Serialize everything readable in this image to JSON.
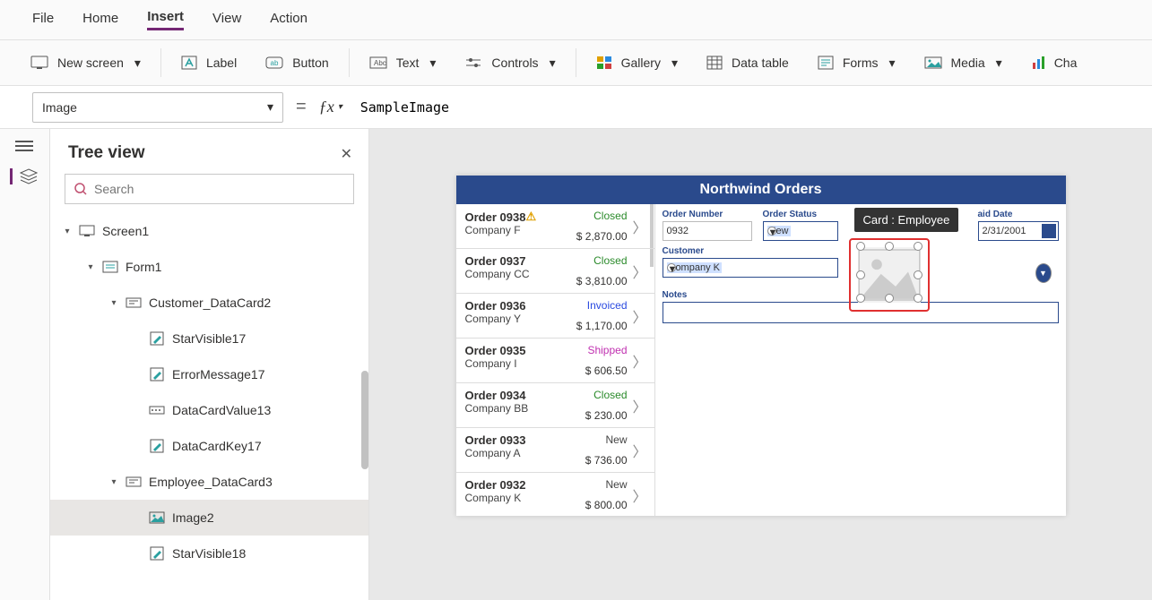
{
  "menu": {
    "items": [
      "File",
      "Home",
      "Insert",
      "View",
      "Action"
    ],
    "active": 2
  },
  "ribbon": {
    "new_screen": "New screen",
    "label": "Label",
    "button": "Button",
    "text": "Text",
    "controls": "Controls",
    "gallery": "Gallery",
    "data_table": "Data table",
    "forms": "Forms",
    "media": "Media",
    "charts": "Cha"
  },
  "formula": {
    "property": "Image",
    "value": "SampleImage"
  },
  "tree": {
    "title": "Tree view",
    "search_placeholder": "Search",
    "nodes": [
      {
        "depth": 0,
        "caret": "▾",
        "icon": "screen",
        "label": "Screen1"
      },
      {
        "depth": 1,
        "caret": "▾",
        "icon": "form",
        "label": "Form1"
      },
      {
        "depth": 2,
        "caret": "▾",
        "icon": "card",
        "label": "Customer_DataCard2"
      },
      {
        "depth": 3,
        "caret": "",
        "icon": "edit",
        "label": "StarVisible17"
      },
      {
        "depth": 3,
        "caret": "",
        "icon": "edit",
        "label": "ErrorMessage17"
      },
      {
        "depth": 3,
        "caret": "",
        "icon": "combo",
        "label": "DataCardValue13"
      },
      {
        "depth": 3,
        "caret": "",
        "icon": "edit",
        "label": "DataCardKey17"
      },
      {
        "depth": 2,
        "caret": "▾",
        "icon": "card",
        "label": "Employee_DataCard3"
      },
      {
        "depth": 3,
        "caret": "",
        "icon": "image",
        "label": "Image2",
        "selected": true
      },
      {
        "depth": 3,
        "caret": "",
        "icon": "edit",
        "label": "StarVisible18"
      }
    ]
  },
  "app": {
    "title": "Northwind Orders",
    "tooltip": "Card : Employee",
    "orders": [
      {
        "id": "Order 0938",
        "company": "Company F",
        "status": "Closed",
        "amount": "$ 2,870.00",
        "warn": true
      },
      {
        "id": "Order 0937",
        "company": "Company CC",
        "status": "Closed",
        "amount": "$ 3,810.00"
      },
      {
        "id": "Order 0936",
        "company": "Company Y",
        "status": "Invoiced",
        "amount": "$ 1,170.00"
      },
      {
        "id": "Order 0935",
        "company": "Company I",
        "status": "Shipped",
        "amount": "$ 606.50"
      },
      {
        "id": "Order 0934",
        "company": "Company BB",
        "status": "Closed",
        "amount": "$ 230.00"
      },
      {
        "id": "Order 0933",
        "company": "Company A",
        "status": "New",
        "amount": "$ 736.00"
      },
      {
        "id": "Order 0932",
        "company": "Company K",
        "status": "New",
        "amount": "$ 800.00"
      }
    ],
    "form": {
      "order_number_label": "Order Number",
      "order_number": "0932",
      "order_status_label": "Order Status",
      "order_status": "New",
      "paid_date_label": "aid Date",
      "paid_date": "2/31/2001",
      "customer_label": "Customer",
      "customer": "Company K",
      "notes_label": "Notes"
    }
  }
}
